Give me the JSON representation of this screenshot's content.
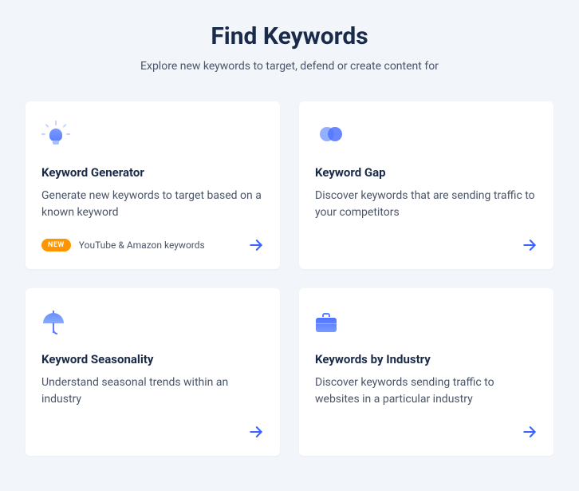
{
  "header": {
    "title": "Find Keywords",
    "subtitle": "Explore new keywords to target, defend or create content for"
  },
  "cards": [
    {
      "title": "Keyword Generator",
      "description": "Generate new keywords to target based on a known keyword",
      "badge": "NEW",
      "badgeText": "YouTube & Amazon keywords"
    },
    {
      "title": "Keyword Gap",
      "description": "Discover keywords that are sending traffic to your competitors"
    },
    {
      "title": "Keyword Seasonality",
      "description": "Understand seasonal trends within an industry"
    },
    {
      "title": "Keywords by Industry",
      "description": "Discover keywords sending traffic to websites in a particular industry"
    }
  ]
}
